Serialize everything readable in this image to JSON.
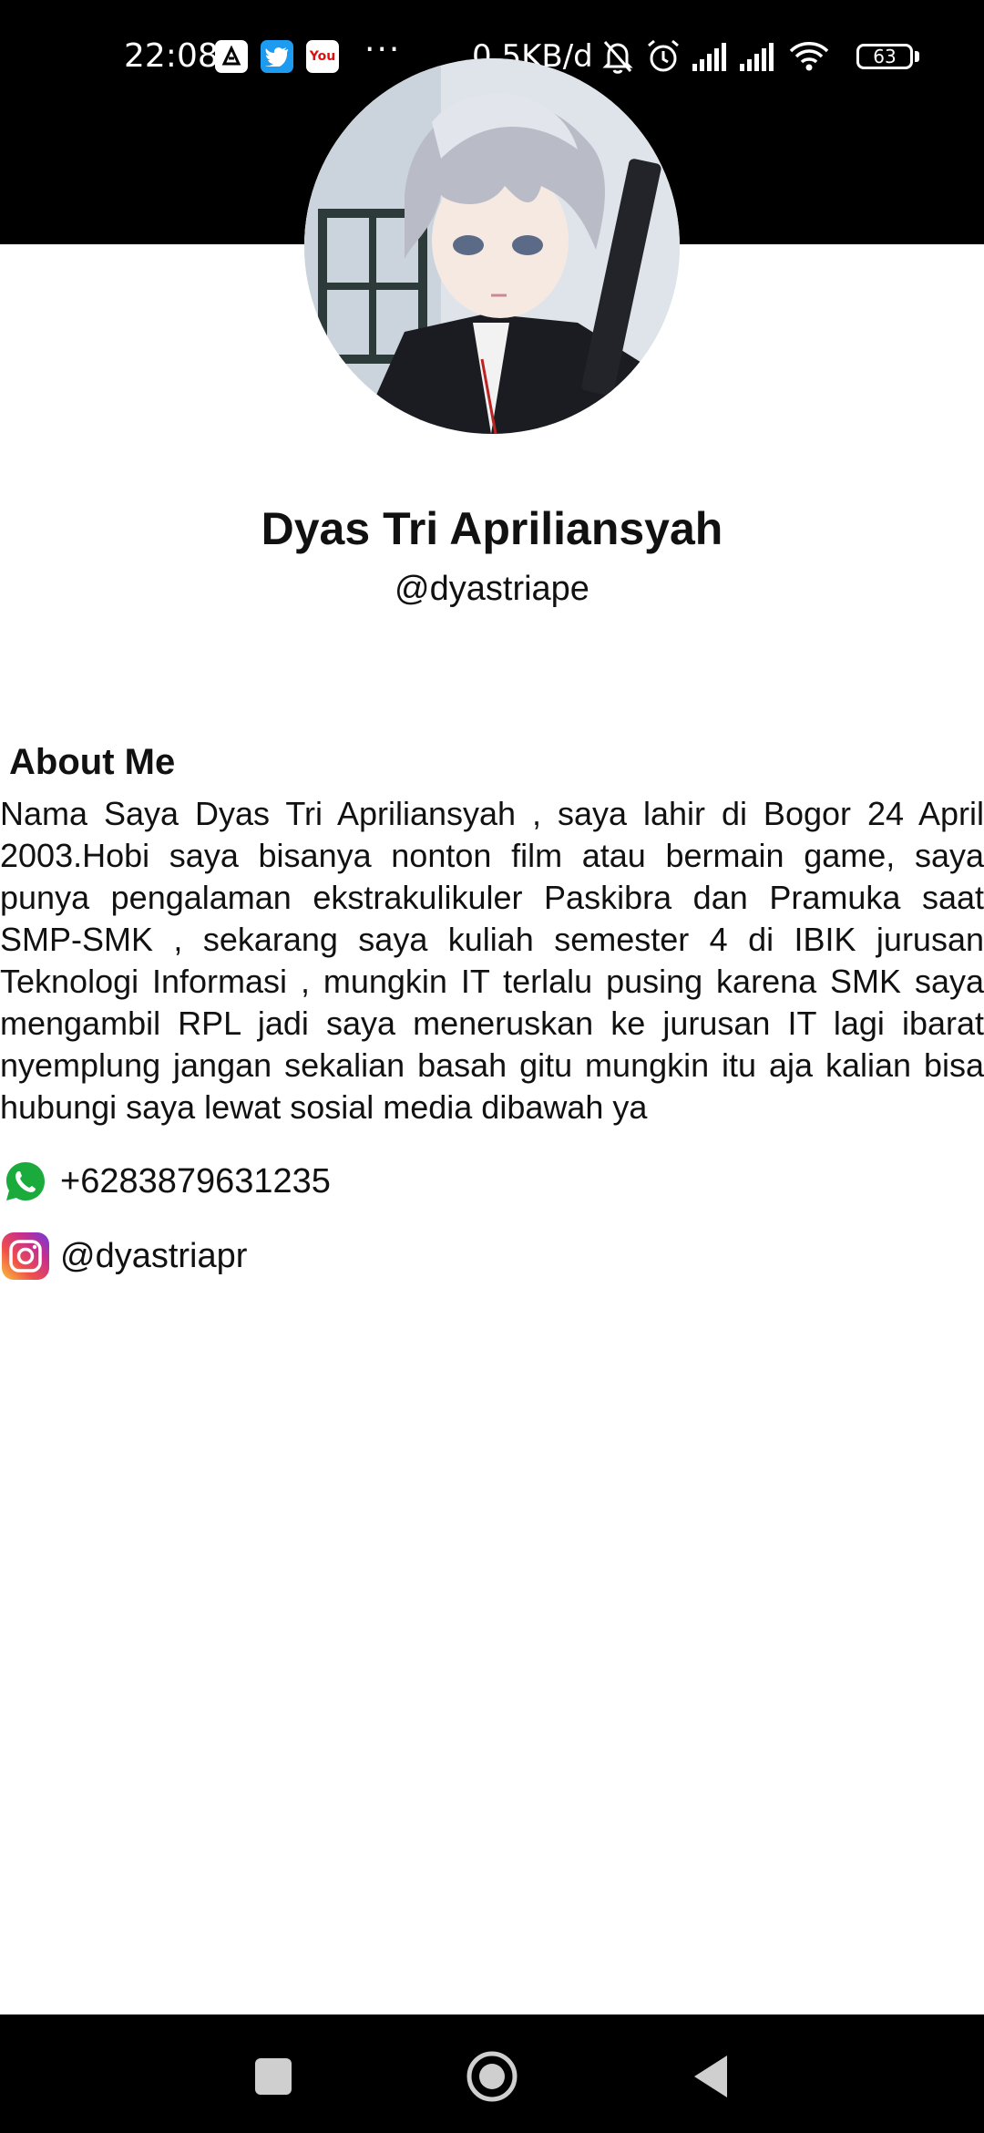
{
  "status_bar": {
    "time": "22:08",
    "notification_icons": [
      "app-notification-icon",
      "twitter-icon",
      "youtube-icon"
    ],
    "youtube_label": "You",
    "more_indicator": "···",
    "network_speed": "0,5KB/d",
    "system_icons": [
      "mute-bell-icon",
      "alarm-icon",
      "signal-icon",
      "signal-icon",
      "wifi-icon"
    ],
    "battery_level": "63"
  },
  "profile": {
    "name": "Dyas Tri Apriliansyah",
    "handle": "@dyastriape"
  },
  "about": {
    "heading": "About Me",
    "body": "Nama Saya Dyas Tri Apriliansyah , saya lahir di Bogor 24 April 2003.Hobi saya bisanya nonton film atau bermain game, saya punya pengalaman ekstrakulikuler Paskibra dan Pramuka saat SMP-SMK , sekarang saya kuliah semester 4 di IBIK jurusan Teknologi Informasi , mungkin IT terlalu pusing karena SMK saya mengambil RPL jadi saya meneruskan ke jurusan IT lagi ibarat nyemplung jangan sekalian basah gitu mungkin itu aja kalian bisa hubungi saya lewat sosial media dibawah ya"
  },
  "contacts": {
    "whatsapp": {
      "icon": "whatsapp-icon",
      "value": "+6283879631235",
      "color": "#1aab3c"
    },
    "instagram": {
      "icon": "instagram-icon",
      "value": "@dyastriapr"
    }
  },
  "nav_bar": {
    "buttons": [
      "recents-icon",
      "home-icon",
      "back-icon"
    ]
  },
  "colors": {
    "header_background": "#000000",
    "page_background": "#ffffff",
    "text": "#111111"
  }
}
